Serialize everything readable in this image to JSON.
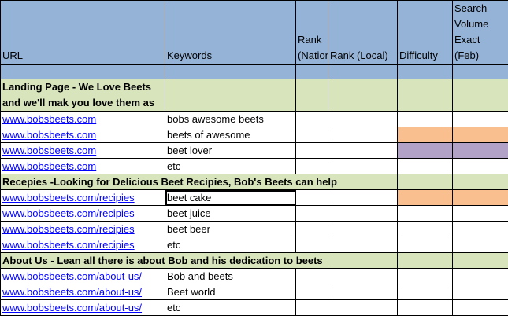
{
  "headers": {
    "url": "URL",
    "keywords": "Keywords",
    "rank_national": "Rank (National)",
    "rank_local": "Rank (Local)",
    "difficulty": "Difficulty",
    "search_volume": "Search Volume Exact (Feb)"
  },
  "sections": [
    {
      "title": "Landing Page - We Love Beets and we'll mak you love them as",
      "rows": [
        {
          "url": "www.bobsbeets.com",
          "keyword": "bobs awesome beets"
        },
        {
          "url": "www.bobsbeets.com",
          "keyword": "beets of awesome"
        },
        {
          "url": "www.bobsbeets.com",
          "keyword": "beet lover"
        },
        {
          "url": "www.bobsbeets.com",
          "keyword": "etc"
        }
      ]
    },
    {
      "title": "Recepies -Looking for Delicious Beet Recipies, Bob's Beets can help",
      "rows": [
        {
          "url": "www.bobsbeets.com/recipies",
          "keyword": "beet cake"
        },
        {
          "url": "www.bobsbeets.com/recipies",
          "keyword": "beet juice"
        },
        {
          "url": "www.bobsbeets.com/recipies",
          "keyword": "beet beer"
        },
        {
          "url": "www.bobsbeets.com/recipies",
          "keyword": "etc"
        }
      ]
    },
    {
      "title": "About Us - Lean all there is about Bob and his dedication to beets",
      "rows": [
        {
          "url": "www.bobsbeets.com/about-us/",
          "keyword": "Bob and beets"
        },
        {
          "url": "www.bobsbeets.com/about-us/",
          "keyword": "Beet world"
        },
        {
          "url": "www.bobsbeets.com/about-us/",
          "keyword": "etc"
        }
      ]
    }
  ],
  "colors": {
    "header_blue": "#95b3d7",
    "section_green": "#d7e4bc",
    "highlight_orange": "#fabf8f",
    "highlight_purple": "#b2a2c7",
    "link_blue": "#0000ff"
  }
}
